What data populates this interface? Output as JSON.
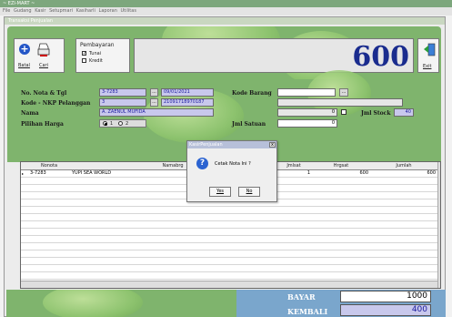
{
  "app": {
    "title": "~ EZI-MART ~",
    "menu": [
      "File",
      "Gudang",
      "Kasir",
      "Setupmari",
      "Kasiharli",
      "Laporan",
      "Utilitas"
    ]
  },
  "window": {
    "title": "Transaksi Penjualan"
  },
  "toolbar": {
    "batal_label": "Batal",
    "cari_label": "Cari",
    "exit_label": "Exit"
  },
  "pembayaran": {
    "title": "Pembayaran",
    "tunai_label": "Tunai",
    "tunai_checked": true,
    "kredit_label": "Kredit",
    "kredit_checked": false
  },
  "total_display": "600",
  "form": {
    "nota_label": "No. Nota & Tgl",
    "nota_value": "3-7283",
    "tgl_value": "09/01/2021",
    "kode_label": "Kode - NKP Pelanggan",
    "kode_value": "3",
    "nkp_value": "21091718970187",
    "nama_label": "Nama",
    "nama_value": "A. ZAENUL MUFIDA",
    "pilihan_label": "Pilihan Harga",
    "pilihan_1": "1",
    "pilihan_2": "2",
    "pilihan_selected": "1",
    "kode_barang_label": "Kode Barang",
    "kode_barang_value": "",
    "harga_value": "0",
    "jml_stock_label": "Jml Stock",
    "jml_stock_value": "40",
    "jml_satuan_label": "Jml Satuan",
    "jml_satuan_value": "0",
    "dot_btn": "..."
  },
  "grid": {
    "columns": [
      "Nonota",
      "Namabrg",
      "Jmlsat",
      "Hrgsat",
      "Jumlah"
    ],
    "rows": [
      {
        "nonota": "3-7283",
        "namabrg": "YUPI SEA WORLD",
        "jmlsat": "1",
        "hrgsat": "600",
        "jumlah": "600"
      }
    ]
  },
  "bottom": {
    "bayar_label": "BAYAR",
    "bayar_value": "1000",
    "kembali_label": "KEMBALI",
    "kembali_value": "400"
  },
  "dialog": {
    "title": "KasirPenjualan",
    "close": "x",
    "message": "Cetak Nota Ini ?",
    "yes_label": "Yes",
    "no_label": "No"
  }
}
